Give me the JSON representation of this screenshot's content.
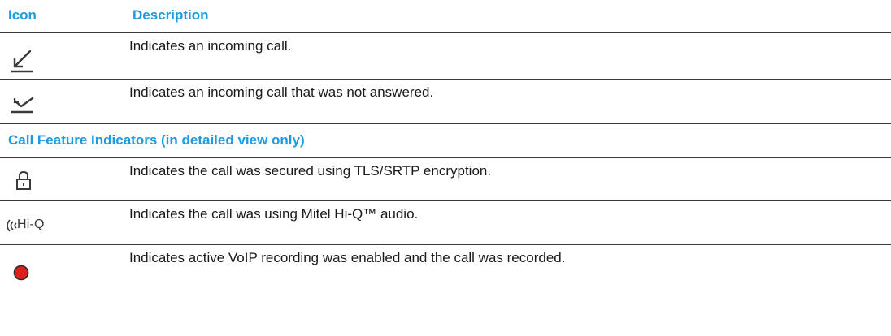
{
  "table": {
    "header": {
      "icon": "Icon",
      "description": "Description"
    },
    "rows": [
      {
        "icon": "incoming-call-icon",
        "description": "Indicates an incoming call."
      },
      {
        "icon": "missed-call-icon",
        "description": "Indicates an incoming call that was not answered."
      }
    ],
    "section_title": "Call Feature Indicators (in detailed view only)",
    "feature_rows": [
      {
        "icon": "lock-icon",
        "description": "Indicates the call was secured using TLS/SRTP encryption."
      },
      {
        "icon": "hi-q-icon",
        "icon_text": "Hi-Q",
        "description": "Indicates the call was using Mitel Hi-Q™ audio."
      },
      {
        "icon": "recording-icon",
        "description": "Indicates active VoIP recording was enabled and the call was recorded."
      }
    ]
  },
  "colors": {
    "accent": "#1d9be0",
    "text": "#1a1a1a",
    "rule": "#3a3a3a",
    "recording_red": "#e0201c"
  }
}
